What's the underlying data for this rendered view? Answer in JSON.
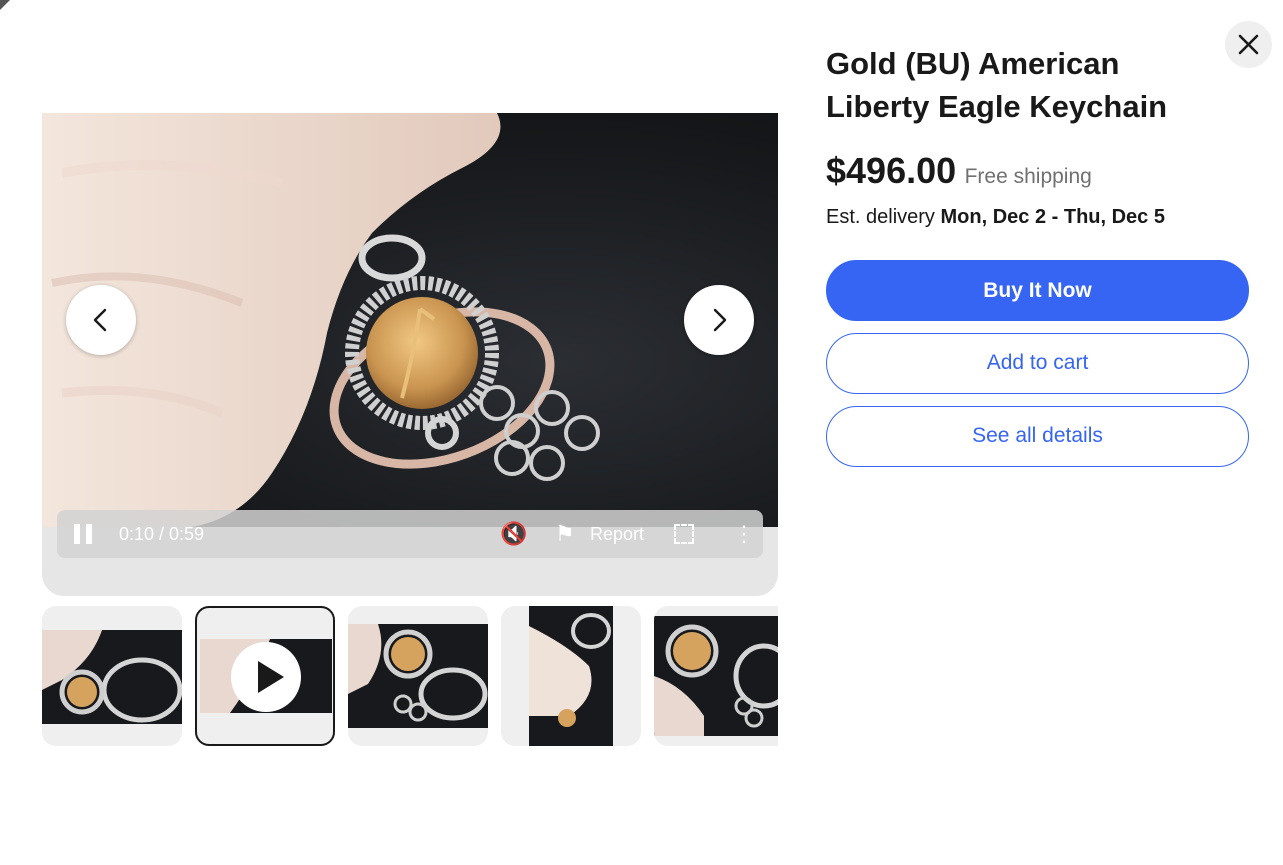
{
  "product": {
    "title": "Gold (BU) American Liberty Eagle Keychain",
    "price": "$496.00",
    "shipping": "Free shipping",
    "delivery_prefix": "Est. delivery",
    "delivery_dates": "Mon, Dec 2 - Thu, Dec 5"
  },
  "actions": {
    "buy_now": "Buy It Now",
    "add_to_cart": "Add to cart",
    "see_details": "See all details"
  },
  "video": {
    "time": "0:10 / 0:59",
    "report_label": "Report",
    "state": "playing",
    "muted": true
  },
  "thumbnails": {
    "count": 5,
    "selected_index": 1,
    "types": [
      "image",
      "video",
      "image",
      "image",
      "image"
    ]
  },
  "colors": {
    "primary": "#3665f3",
    "text": "#191919",
    "muted_text": "#707070"
  },
  "icons": [
    "chevron-left-icon",
    "chevron-right-icon",
    "close-icon",
    "play-icon",
    "pause-icon",
    "mute-icon",
    "flag-icon",
    "fullscreen-icon",
    "more-icon"
  ]
}
